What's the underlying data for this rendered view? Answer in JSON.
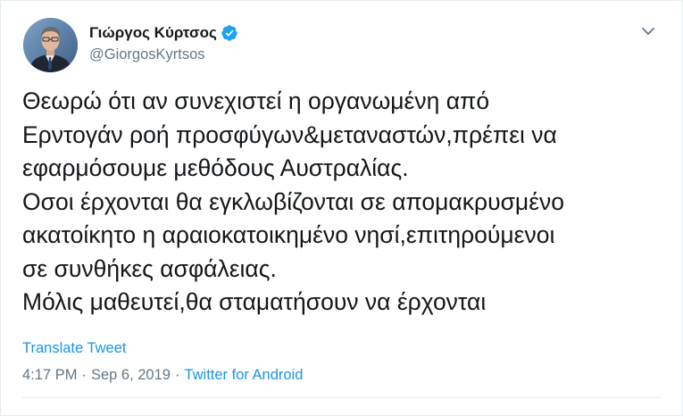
{
  "author": {
    "display_name": "Γιώργος Κύρτσος",
    "handle": "@GiorgosKyrtsos",
    "verified": true,
    "avatar_icon": "avatar-photo"
  },
  "tweet": {
    "lines": [
      "Θεωρώ ότι αν συνεχιστεί η οργανωμένη από",
      "Ερντογάν ροή προσφύγων&μεταναστών,πρέπει να",
      "εφαρμόσουμε μεθόδους Αυστραλίας.",
      "Οσοι έρχονται θα εγκλωβίζονται σε απομακρυσμένο",
      "ακατοίκητο η αραιοκατοικημένο νησί,επιτηρούμενοι",
      "σε συνθήκες ασφάλειας.",
      "Μόλις μαθευτεί,θα σταματήσουν να έρχονται"
    ],
    "translate_label": "Translate Tweet",
    "time": "4:17 PM",
    "separator": "·",
    "date": "Sep 6, 2019",
    "source": "Twitter for Android"
  },
  "colors": {
    "link": "#1b95e0",
    "muted": "#657786",
    "text": "#14171a",
    "verified": "#1da1f2"
  },
  "icons": {
    "verified": "verified-badge-icon",
    "menu": "chevron-down-icon"
  }
}
